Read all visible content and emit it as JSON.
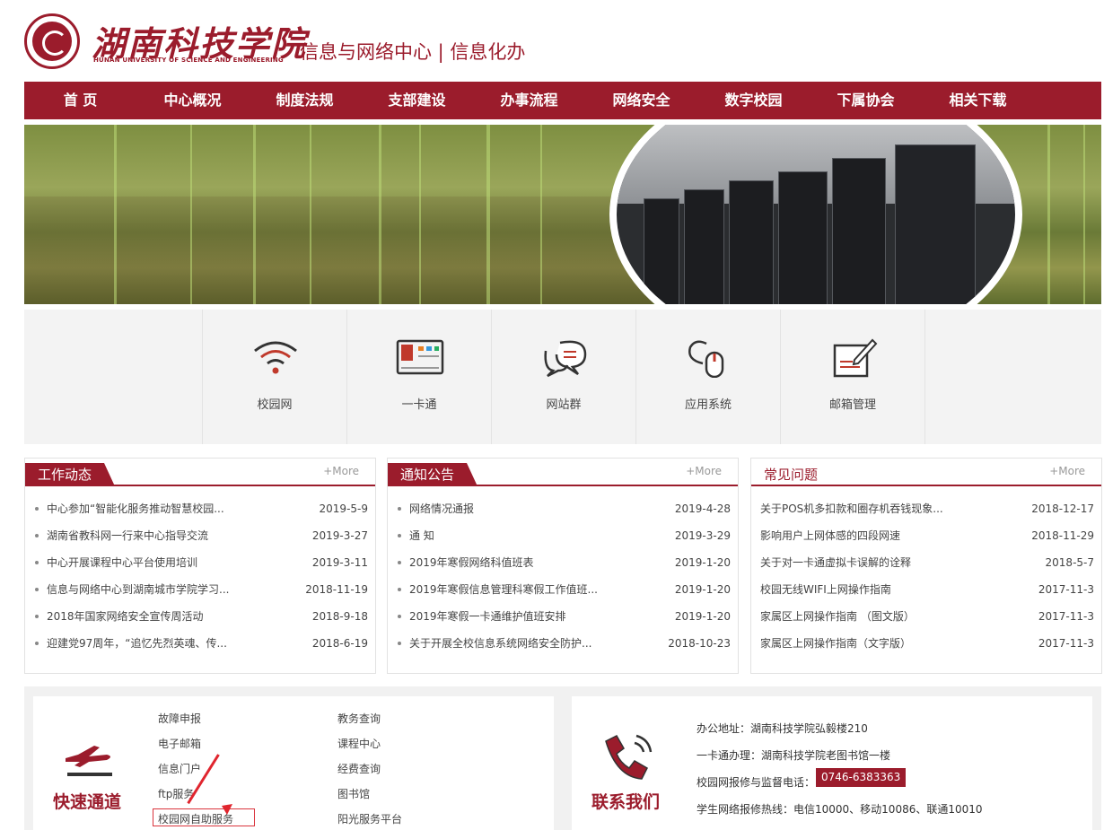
{
  "header": {
    "logo_cn": "湖南科技学院",
    "logo_en": "HUNAN UNIVERSITY OF SCIENCE AND ENGINEERING",
    "site_title": "信息与网络中心 | 信息化办"
  },
  "nav": [
    "首 页",
    "中心概况",
    "制度法规",
    "支部建设",
    "办事流程",
    "网络安全",
    "数字校园",
    "下属协会",
    "相关下载"
  ],
  "services": [
    {
      "label": "校园网",
      "icon": "wifi-icon"
    },
    {
      "label": "一卡通",
      "icon": "card-icon"
    },
    {
      "label": "网站群",
      "icon": "chat-bubbles-icon"
    },
    {
      "label": "应用系统",
      "icon": "mouse-icon"
    },
    {
      "label": "邮箱管理",
      "icon": "edit-icon"
    }
  ],
  "panels": {
    "work": {
      "title": "工作动态",
      "more": "+More",
      "items": [
        {
          "t": "中心参加“智能化服务推动智慧校园...",
          "d": "2019-5-9"
        },
        {
          "t": "湖南省教科网一行来中心指导交流",
          "d": "2019-3-27"
        },
        {
          "t": "中心开展课程中心平台使用培训",
          "d": "2019-3-11"
        },
        {
          "t": "信息与网络中心到湖南城市学院学习...",
          "d": "2018-11-19"
        },
        {
          "t": "2018年国家网络安全宣传周活动",
          "d": "2018-9-18"
        },
        {
          "t": "迎建党97周年，“追忆先烈英魂、传...",
          "d": "2018-6-19"
        }
      ]
    },
    "notice": {
      "title": "通知公告",
      "more": "+More",
      "items": [
        {
          "t": "网络情况通报",
          "d": "2019-4-28"
        },
        {
          "t": "通 知",
          "d": "2019-3-29"
        },
        {
          "t": "2019年寒假网络科值班表",
          "d": "2019-1-20"
        },
        {
          "t": "2019年寒假信息管理科寒假工作值班...",
          "d": "2019-1-20"
        },
        {
          "t": "2019年寒假一卡通维护值班安排",
          "d": "2019-1-20"
        },
        {
          "t": "关于开展全校信息系统网络安全防护...",
          "d": "2018-10-23"
        }
      ]
    },
    "faq": {
      "title": "常见问题",
      "more": "+More",
      "items": [
        {
          "t": "关于POS机多扣款和圈存机吞钱现象...",
          "d": "2018-12-17"
        },
        {
          "t": "影响用户上网体感的四段网速",
          "d": "2018-11-29"
        },
        {
          "t": "关于对一卡通虚拟卡误解的诠释",
          "d": "2018-5-7"
        },
        {
          "t": "校园无线WIFI上网操作指南",
          "d": "2017-11-3"
        },
        {
          "t": "家属区上网操作指南 （图文版）",
          "d": "2017-11-3"
        },
        {
          "t": "家属区上网操作指南（文字版）",
          "d": "2017-11-3"
        }
      ]
    }
  },
  "quick": {
    "title": "快速通道",
    "col1": [
      "故障申报",
      "电子邮箱",
      "信息门户",
      "ftp服务",
      "校园网自助服务"
    ],
    "col2": [
      "教务查询",
      "课程中心",
      "经费查询",
      "图书馆",
      "阳光服务平台"
    ]
  },
  "contact": {
    "title": "联系我们",
    "address": "办公地址：湖南科技学院弘毅楼210",
    "card": "一卡通办理：湖南科技学院老图书馆一楼",
    "repair_label": "校园网报修与监督电话：",
    "repair_phone": "0746-6383363",
    "student": "学生网络报修热线：电信10000、移动10086、联通10010"
  },
  "colors": {
    "brand": "#9b1c2c",
    "highlight": "#d9343d"
  }
}
